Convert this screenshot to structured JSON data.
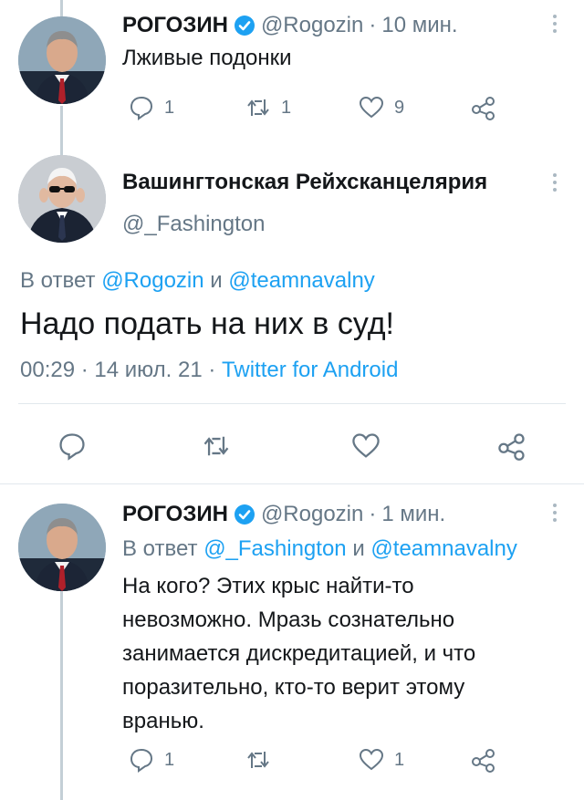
{
  "tweets": [
    {
      "author_name": "РОГОЗИН",
      "handle": "@Rogozin",
      "separator": "·",
      "time": "10 мин.",
      "text": "Лживые подонки",
      "replies": "1",
      "retweets": "1",
      "likes": "9"
    },
    {
      "author_name": "Вашингтонская Рейхсканцелярия",
      "handle": "@_Fashington",
      "reply_prefix": "В ответ",
      "reply_to_1": "@Rogozin",
      "reply_and": "и",
      "reply_to_2": "@teamnavalny",
      "text": "Надо подать на них в суд!",
      "meta_time": "00:29",
      "meta_sep1": "·",
      "meta_date": "14 июл. 21",
      "meta_sep2": "·",
      "meta_source": "Twitter for Android"
    },
    {
      "author_name": "РОГОЗИН",
      "handle": "@Rogozin",
      "separator": "·",
      "time": "1 мин.",
      "reply_prefix": "В ответ",
      "reply_to_1": "@_Fashington",
      "reply_and": "и",
      "reply_to_2": "@teamnavalny",
      "text_lines": [
        "На кого? Этих крыс найти-то",
        "невозможно. Мразь сознательно",
        "занимается дискредитацией, и что",
        "поразительно, кто-то верит этому",
        "вранью."
      ],
      "replies": "1",
      "likes": "1"
    }
  ],
  "colors": {
    "accent": "#1da1f2",
    "secondary_text": "#657786",
    "thread_line": "#c4cfd6"
  },
  "icons": [
    "reply-icon",
    "retweet-icon",
    "like-icon",
    "share-icon",
    "verified-badge-icon",
    "more-menu-icon"
  ]
}
